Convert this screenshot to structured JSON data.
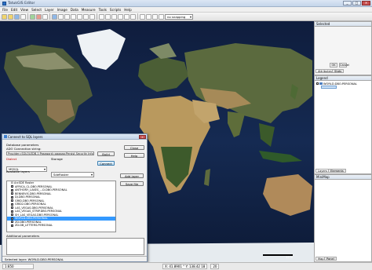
{
  "app": {
    "title": "TatukGIS Editor"
  },
  "window_controls": {
    "minimize": "_",
    "maximize": "□",
    "close": "✕"
  },
  "menu": [
    "File",
    "Edit",
    "View",
    "Select",
    "Layer",
    "Image",
    "Data",
    "Measure",
    "Tools",
    "Scripts",
    "Help"
  ],
  "toolbar": {
    "zoom_mode": "no snapping"
  },
  "right": {
    "selected_header": "Selected",
    "selected_tabs": [
      "Attributes",
      "Stats"
    ],
    "mini_buttons": [
      "OK",
      "Cancel"
    ],
    "legend_header": "Legend",
    "legend_layer": "WORLD.DBO.PERSONAL",
    "legend_tabs": [
      "Layers",
      "Elements"
    ],
    "minimap_header": "MiniMap",
    "minimap_tabs": [
      "Map",
      "Panel"
    ]
  },
  "map": {
    "scale_label": "40 ki"
  },
  "dialog": {
    "title": "Connect to SQL layers",
    "db_params_label": "Database parameters",
    "ado_label": "ADO Connection string:",
    "ado_value": "Provider=SQLOLEDB.1;Password=aaaaaa;Persist Security Info=Tr...",
    "dialect_label": "Dialect",
    "dialect_value": "MSSQL",
    "storage_label": "Storage",
    "storage_value": "SdeRaster",
    "build_button": "Build",
    "connect_button": "Connect",
    "close_button": "Close",
    "help_button": "Help",
    "add_layer_button": "Add layer",
    "save_file_button": "Save file",
    "available_label": "Available layers",
    "root_item": "ArcSDE Raster",
    "layers": [
      "AFRICA_CL.DBO.PERSONAL",
      "ANTHONY_LAKES_...D.DBO.PERSONAL",
      "BENNEVIS.DBO.PERSONAL",
      "DJ.DBO.PERSONAL",
      "GRID.DBO.PERSONAL",
      "GRID2.DBO.PERSONAL",
      "LAS_VEGAS.DBO.PERSONAL",
      "LAS_VEGAS_STRIP.DBO.PERSONAL",
      "SH_LAS_VEGAS.DBO.PERSONAL",
      "WORLD.DBO.PERSONAL",
      "ZD.DBO.PERSONAL",
      "ZD.DB_LETTERS.PERSONAL"
    ],
    "selected_layer_index": 9,
    "additional_label": "Additional parameters",
    "status_prefix": "Selected layer:",
    "status_value": "WORLD.DBO.PERSONAL"
  },
  "status": {
    "scale": "1:850",
    "coords": "X: 41.8901 ° Y: 138.42 18",
    "zoom": "20"
  }
}
